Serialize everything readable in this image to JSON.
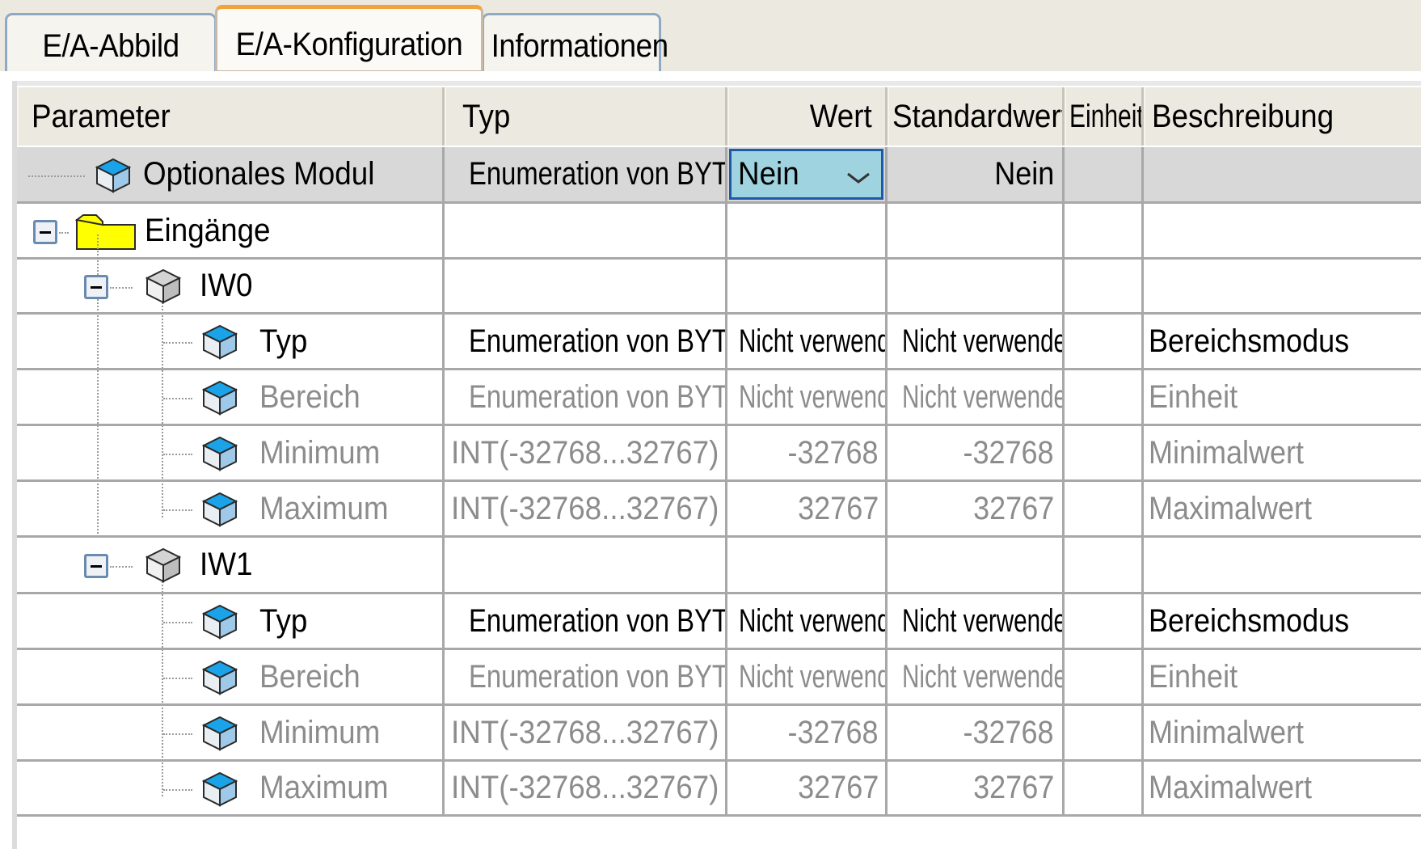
{
  "tabs": [
    {
      "label": "E/A-Abbild",
      "active": false
    },
    {
      "label": "E/A-Konfiguration",
      "active": true
    },
    {
      "label": "Informationen",
      "active": false
    }
  ],
  "columns": {
    "parameter": "Parameter",
    "typ": "Typ",
    "wert": "Wert",
    "standardwert": "Standardwert",
    "einheit": "Einheit",
    "beschreibung": "Beschreibung"
  },
  "rows": [
    {
      "name": "Optionales Modul",
      "typ": "Enumeration von BYTE",
      "wert": "Nein",
      "standardwert": "Nein",
      "einheit": "",
      "beschreibung": "",
      "icon": "parameter-cube-icon",
      "editable_dropdown": true
    },
    {
      "name": "Eingänge",
      "typ": "",
      "wert": "",
      "standardwert": "",
      "einheit": "",
      "beschreibung": "",
      "icon": "folder-icon",
      "expanded": true
    },
    {
      "name": "IW0",
      "typ": "",
      "wert": "",
      "standardwert": "",
      "einheit": "",
      "beschreibung": "",
      "icon": "channel-cube-icon",
      "expanded": true
    },
    {
      "name": "Typ",
      "typ": "Enumeration von BYTE",
      "wert": "Nicht verwendet",
      "standardwert": "Nicht verwendet",
      "einheit": "",
      "beschreibung": "Bereichsmodus",
      "icon": "parameter-cube-icon",
      "disabled": false
    },
    {
      "name": "Bereich",
      "typ": "Enumeration von BYTE",
      "wert": "Nicht verwendet",
      "standardwert": "Nicht verwendet",
      "einheit": "",
      "beschreibung": "Einheit",
      "icon": "parameter-cube-icon",
      "disabled": true
    },
    {
      "name": "Minimum",
      "typ": "INT(-32768...32767)",
      "wert": "-32768",
      "standardwert": "-32768",
      "einheit": "",
      "beschreibung": "Minimalwert",
      "icon": "parameter-cube-icon",
      "disabled": true
    },
    {
      "name": "Maximum",
      "typ": "INT(-32768...32767)",
      "wert": "32767",
      "standardwert": "32767",
      "einheit": "",
      "beschreibung": "Maximalwert",
      "icon": "parameter-cube-icon",
      "disabled": true
    },
    {
      "name": "IW1",
      "typ": "",
      "wert": "",
      "standardwert": "",
      "einheit": "",
      "beschreibung": "",
      "icon": "channel-cube-icon",
      "expanded": true
    },
    {
      "name": "Typ",
      "typ": "Enumeration von BYTE",
      "wert": "Nicht verwendet",
      "standardwert": "Nicht verwendet",
      "einheit": "",
      "beschreibung": "Bereichsmodus",
      "icon": "parameter-cube-icon",
      "disabled": false
    },
    {
      "name": "Bereich",
      "typ": "Enumeration von BYTE",
      "wert": "Nicht verwendet",
      "standardwert": "Nicht verwendet",
      "einheit": "",
      "beschreibung": "Einheit",
      "icon": "parameter-cube-icon",
      "disabled": true
    },
    {
      "name": "Minimum",
      "typ": "INT(-32768...32767)",
      "wert": "-32768",
      "standardwert": "-32768",
      "einheit": "",
      "beschreibung": "Minimalwert",
      "icon": "parameter-cube-icon",
      "disabled": true
    },
    {
      "name": "Maximum",
      "typ": "INT(-32768...32767)",
      "wert": "32767",
      "standardwert": "32767",
      "einheit": "",
      "beschreibung": "Maximalwert",
      "icon": "parameter-cube-icon",
      "disabled": true
    }
  ],
  "colors": {
    "tab_active_accent": "#f2a33a",
    "selected_row": "#d8d8d8",
    "dropdown_fill": "#9fd3df",
    "dropdown_border": "#1e5aa8",
    "folder": "#ffff00",
    "disabled_text": "#8c8c8c"
  }
}
